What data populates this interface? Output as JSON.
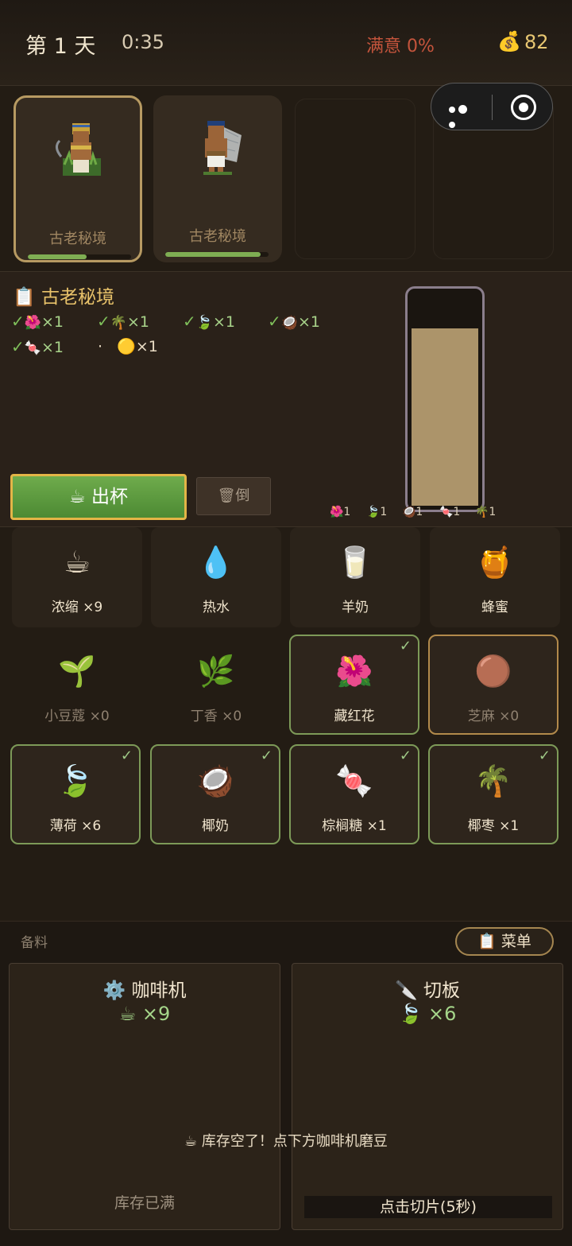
{
  "header": {
    "day": "第 1 天",
    "time": "0:35",
    "satisfaction": "满意 0%",
    "coin_icon": "💰",
    "coins": "82"
  },
  "customers": [
    {
      "name": "古老秘境",
      "patience": 0.57
    },
    {
      "name": "古老秘境",
      "patience": 0.92
    }
  ],
  "order": {
    "title": "📋 古老秘境",
    "requirements": [
      {
        "check": "✓",
        "icon": "🌺",
        "qty": "×1"
      },
      {
        "check": "✓",
        "icon": "🌴",
        "qty": "×1"
      },
      {
        "check": "✓",
        "icon": "🍃",
        "qty": "×1"
      },
      {
        "check": "✓",
        "icon": "🥥",
        "qty": "×1"
      },
      {
        "check": "✓",
        "icon": "🍬",
        "qty": "×1"
      }
    ],
    "pending": {
      "bullet": "·",
      "icon": "🟡",
      "qty": "×1"
    },
    "serve_label": "☕ 出杯",
    "dump_label": "🗑倒",
    "cup_fill": 0.82,
    "cup_mix": [
      "🌺1",
      "🍃1",
      "🥥1",
      "🍬1",
      "🌴1"
    ]
  },
  "ingredients": [
    {
      "icon": "☕",
      "label": "浓缩 ×9"
    },
    {
      "icon": "💧",
      "label": "热水"
    },
    {
      "icon": "🥛",
      "label": "羊奶"
    },
    {
      "icon": "🍯",
      "label": "蜂蜜"
    },
    {
      "icon": "🌱",
      "label": "小豆蔻 ×0"
    },
    {
      "icon": "🌿",
      "label": "丁香 ×0"
    },
    {
      "icon": "🌺",
      "label": "藏红花",
      "check": "✓"
    },
    {
      "icon": "🟤",
      "label": "芝麻 ×0"
    },
    {
      "icon": "🍃",
      "label": "薄荷 ×6",
      "check": "✓"
    },
    {
      "icon": "🥥",
      "label": "椰奶",
      "check": "✓"
    },
    {
      "icon": "🍬",
      "label": "棕榈糖 ×1",
      "check": "✓"
    },
    {
      "icon": "🌴",
      "label": "椰枣 ×1",
      "check": "✓"
    }
  ],
  "prep": {
    "header": "备料",
    "menu_label": "📋 菜单",
    "coffee_machine": {
      "title": "⚙️ 咖啡机",
      "count": "☕ ×9",
      "footer": "库存已满"
    },
    "cutting_board": {
      "title": "🔪 切板",
      "count": "🍃 ×6",
      "action": "点击切片(5秒)"
    },
    "notice": "☕ 库存空了！点下方咖啡机磨豆"
  },
  "colors": {
    "background": "#231c14",
    "accent_gold": "#e8c26a",
    "check_green": "#7fbf5a",
    "satisfaction_red": "#c4543c"
  }
}
